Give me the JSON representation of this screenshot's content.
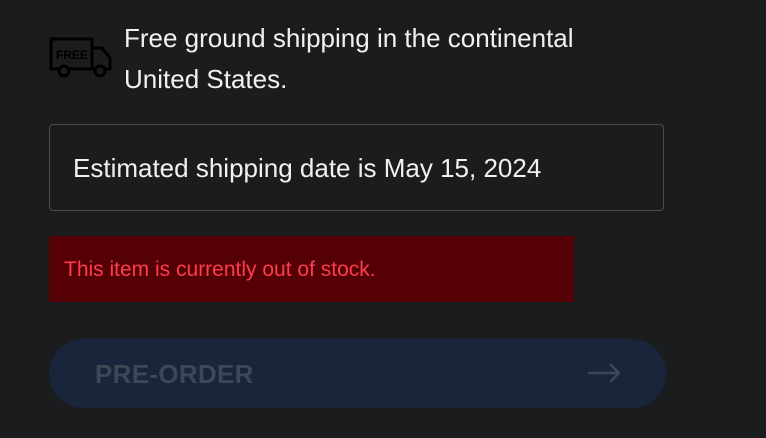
{
  "shipping": {
    "icon": "free-shipping-truck-icon",
    "badge_text": "FREE",
    "message": "Free ground shipping in the continental United States."
  },
  "estimate": {
    "text": "Estimated shipping date is May 15, 2024"
  },
  "stock": {
    "message": "This item is currently out of stock.",
    "text_color": "#ff3b4e",
    "background_color": "#540004"
  },
  "preorder": {
    "label": "PRE-ORDER",
    "icon": "arrow-right-icon",
    "state": "disabled"
  },
  "colors": {
    "background": "#1b1c1e",
    "button_background": "#18253a",
    "button_text": "#3e4756"
  }
}
